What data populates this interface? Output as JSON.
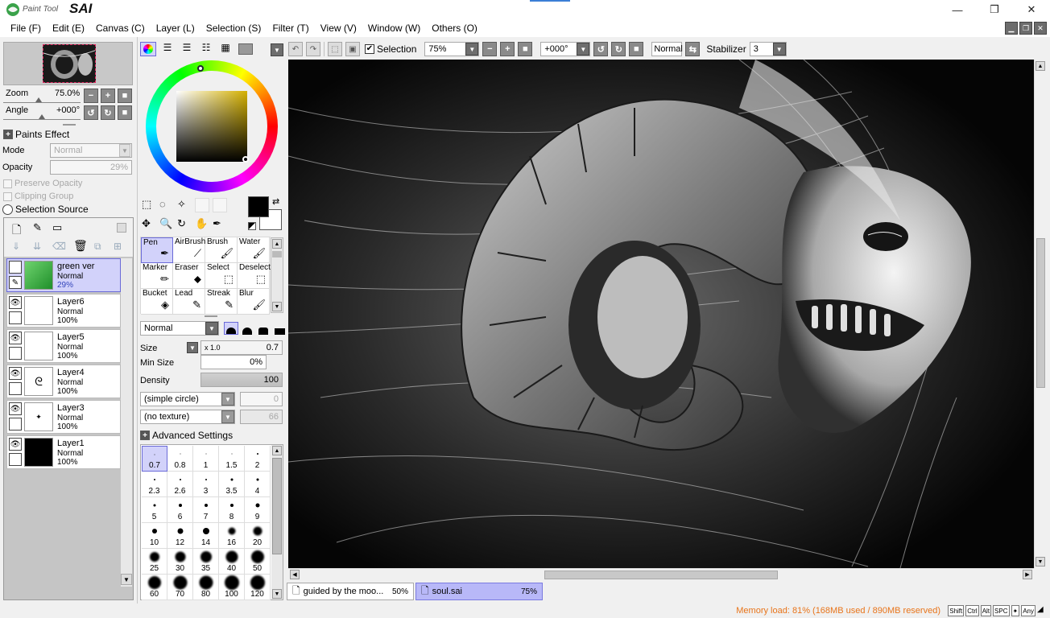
{
  "app": {
    "logo_small": "Paint Tool",
    "logo_big": "SAI"
  },
  "window": {
    "minimize": "—",
    "restore": "❐",
    "close": "✕"
  },
  "menu": [
    "File (F)",
    "Edit (E)",
    "Canvas (C)",
    "Layer (L)",
    "Selection (S)",
    "Filter (T)",
    "View (V)",
    "Window (W)",
    "Others (O)"
  ],
  "navigator": {
    "zoom_label": "Zoom",
    "zoom_value": "75.0%",
    "angle_label": "Angle",
    "angle_value": "+000°"
  },
  "layer_props": {
    "paints_effect": "Paints Effect",
    "mode_label": "Mode",
    "mode_value": "Normal",
    "opacity_label": "Opacity",
    "opacity_value": "29%",
    "preserve_opacity": "Preserve Opacity",
    "clipping_group": "Clipping Group",
    "selection_source": "Selection Source"
  },
  "layers": [
    {
      "name": "green ver",
      "mode": "Normal",
      "opacity": "29%"
    },
    {
      "name": "Layer6",
      "mode": "Normal",
      "opacity": "100%"
    },
    {
      "name": "Layer5",
      "mode": "Normal",
      "opacity": "100%"
    },
    {
      "name": "Layer4",
      "mode": "Normal",
      "opacity": "100%"
    },
    {
      "name": "Layer3",
      "mode": "Normal",
      "opacity": "100%"
    },
    {
      "name": "Layer1",
      "mode": "Normal",
      "opacity": "100%"
    }
  ],
  "tools": [
    [
      "Pen",
      "AirBrush",
      "Brush",
      "Water"
    ],
    [
      "Marker",
      "Eraser",
      "Select",
      "Deselect"
    ],
    [
      "Bucket",
      "Lead",
      "Streak",
      "Blur"
    ]
  ],
  "brush": {
    "blend_mode": "Normal",
    "size_label": "Size",
    "size_mult": "x 1.0",
    "size_value": "0.7",
    "min_size_label": "Min Size",
    "min_size_value": "0%",
    "density_label": "Density",
    "density_value": "100",
    "shape": "(simple circle)",
    "shape_value": "0",
    "texture": "(no texture)",
    "texture_value": "66",
    "advanced": "Advanced Settings"
  },
  "brush_sizes": [
    [
      "0.7",
      "0.8",
      "1",
      "1.5",
      "2"
    ],
    [
      "2.3",
      "2.6",
      "3",
      "3.5",
      "4"
    ],
    [
      "5",
      "6",
      "7",
      "8",
      "9"
    ],
    [
      "10",
      "12",
      "14",
      "16",
      "20"
    ],
    [
      "25",
      "30",
      "35",
      "40",
      "50"
    ],
    [
      "60",
      "70",
      "80",
      "100",
      "120"
    ]
  ],
  "canvas_toolbar": {
    "selection_label": "Selection",
    "zoom": "75%",
    "angle": "+000°",
    "blend": "Normal",
    "stabilizer_label": "Stabilizer",
    "stabilizer_value": "3"
  },
  "tabs": [
    {
      "name": "guided by the moo...",
      "zoom": "50%"
    },
    {
      "name": "soul.sai",
      "zoom": "75%"
    }
  ],
  "status": {
    "memory": "Memory load: 81% (168MB used / 890MB reserved)",
    "keys": [
      "Shift",
      "Ctrl",
      "Alt",
      "SPC",
      "✦",
      "Any"
    ]
  },
  "colors": {
    "accent": "#6a6ad8",
    "selected_bg": "#d2d2fa",
    "status_text": "#e8741a"
  }
}
